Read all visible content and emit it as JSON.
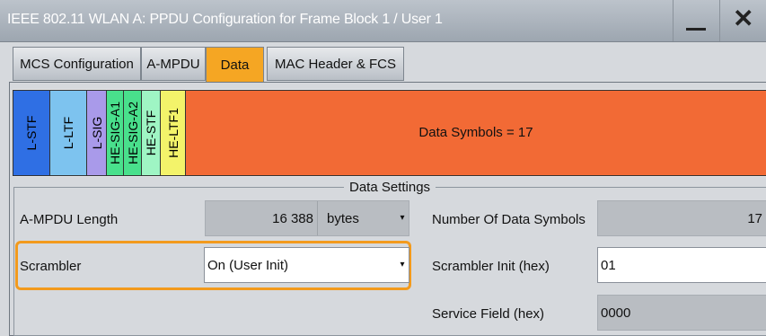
{
  "window": {
    "title": "IEEE 802.11 WLAN  A: PPDU Configuration for Frame Block 1 / User 1",
    "minimize_symbol": "—",
    "close_symbol": "✕"
  },
  "tabs": [
    {
      "label": "MCS Configuration",
      "active": false
    },
    {
      "label": "A-MPDU",
      "active": false
    },
    {
      "label": "Data",
      "active": true
    },
    {
      "label": "MAC Header & FCS",
      "active": false
    }
  ],
  "ppdu_fields": [
    {
      "label": "L-STF",
      "color": "#2f6fe4"
    },
    {
      "label": "L-LTF",
      "color": "#7dc3ef"
    },
    {
      "label": "L-SIG",
      "color": "#a99aea"
    },
    {
      "label": "HE-SIG-A1",
      "color": "#49e08c"
    },
    {
      "label": "HE-SIG-A2",
      "color": "#49e08c"
    },
    {
      "label": "HE-STF",
      "color": "#9ff5c4"
    },
    {
      "label": "HE-LTF1",
      "color": "#f3f36a"
    }
  ],
  "data_symbols_label": "Data Symbols = 17",
  "data_settings": {
    "legend": "Data Settings",
    "ampdu_length_label": "A-MPDU Length",
    "ampdu_length_value": "16 388",
    "ampdu_length_unit": "bytes",
    "num_data_symbols_label": "Number Of Data Symbols",
    "num_data_symbols_value": "17",
    "scrambler_label": "Scrambler",
    "scrambler_value": "On (User Init)",
    "scrambler_init_label": "Scrambler Init (hex)",
    "scrambler_init_value": "01",
    "service_field_label": "Service Field (hex)",
    "service_field_value": "0000"
  },
  "colors": {
    "accent": "#f5a623",
    "data_symbols": "#f26a35"
  }
}
